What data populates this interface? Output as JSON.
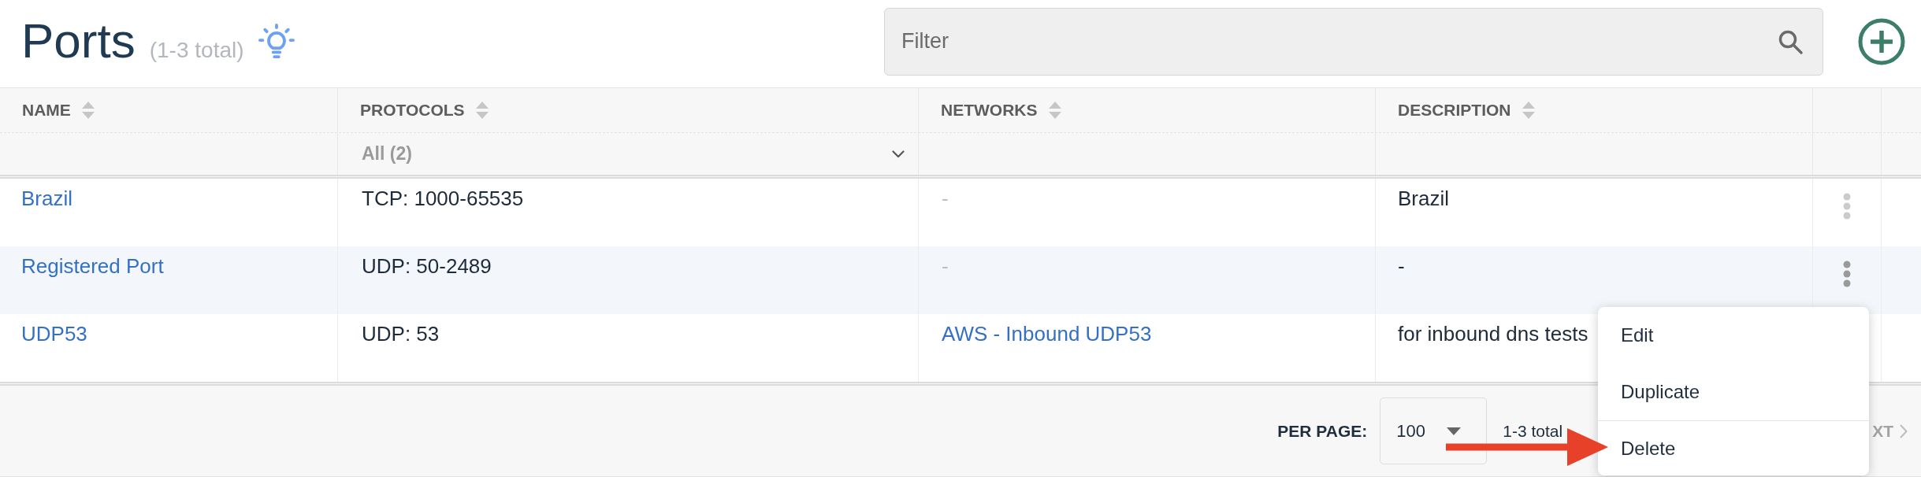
{
  "header": {
    "title": "Ports",
    "count": "(1-3 total)"
  },
  "filter": {
    "placeholder": "Filter"
  },
  "table": {
    "columns": [
      {
        "label": "NAME",
        "sortable": true
      },
      {
        "label": "PROTOCOLS",
        "sortable": true,
        "filter": "All (2)"
      },
      {
        "label": "NETWORKS",
        "sortable": true
      },
      {
        "label": "DESCRIPTION",
        "sortable": true
      }
    ],
    "rows": [
      {
        "name": "Brazil",
        "protocols": "TCP: 1000-65535",
        "networks": {
          "kind": "empty",
          "text": "-"
        },
        "description": "Brazil",
        "highlighted": false,
        "menu_open": false
      },
      {
        "name": "Registered Port",
        "protocols": "UDP: 50-2489",
        "networks": {
          "kind": "empty",
          "text": "-"
        },
        "description": "-",
        "highlighted": true,
        "menu_open": true
      },
      {
        "name": "UDP53",
        "protocols": "UDP: 53",
        "networks": {
          "kind": "link",
          "text": "AWS - Inbound UDP53"
        },
        "description": "for inbound dns tests",
        "highlighted": false,
        "menu_open": false
      }
    ]
  },
  "row_menu": {
    "groups": [
      [
        {
          "label": "Edit"
        },
        {
          "label": "Duplicate"
        }
      ],
      [
        {
          "label": "Delete"
        }
      ]
    ]
  },
  "footer": {
    "per_page_label": "PER PAGE:",
    "per_page": "100",
    "range": "1-3 total",
    "next": {
      "label": "XT",
      "disabled": true
    }
  }
}
